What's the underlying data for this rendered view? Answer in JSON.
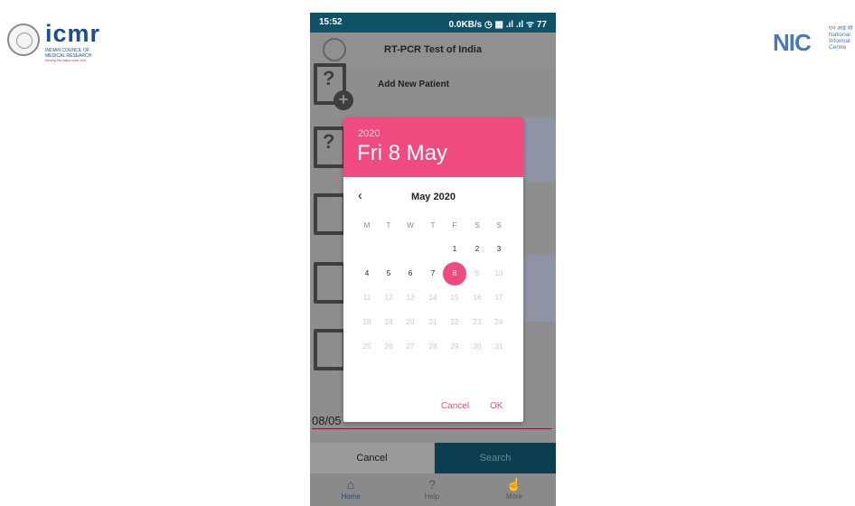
{
  "logos": {
    "left": {
      "word": "icmr",
      "line1": "INDIAN COUNCIL OF",
      "line2": "MEDICAL RESEARCH",
      "tagline": "Serving the nation since 1911"
    },
    "right": {
      "mark": "NIC",
      "line1": "एन आई सी",
      "line2": "National",
      "line3": "Informat",
      "line4": "Centre"
    }
  },
  "status_bar": {
    "time": "15:52",
    "right": "0.0KB/s ◷ ▦ .ıl .ıl ᯤ 77"
  },
  "app": {
    "title": "RT-PCR Test of India",
    "add_new_patient": "Add New Patient",
    "date_field_value": "08/05",
    "cancel_button": "Cancel",
    "search_button": "Search",
    "nav": [
      {
        "label": "Home",
        "icon": "home-icon",
        "glyph": "⌂"
      },
      {
        "label": "Help",
        "icon": "help-icon",
        "glyph": "?"
      },
      {
        "label": "More",
        "icon": "more-icon",
        "glyph": "☝"
      }
    ]
  },
  "date_picker": {
    "year": "2020",
    "selected_date": "Fri 8 May",
    "month_label": "May 2020",
    "prev_icon": "chevron-left-icon",
    "prev_glyph": "‹",
    "weekdays": [
      "M",
      "T",
      "W",
      "T",
      "F",
      "S",
      "S"
    ],
    "days": [
      [
        "",
        "",
        "",
        "",
        "1",
        "2",
        "3"
      ],
      [
        "4",
        "5",
        "6",
        "7",
        "8",
        "9",
        "10"
      ],
      [
        "11",
        "12",
        "13",
        "14",
        "15",
        "16",
        "17"
      ],
      [
        "18",
        "19",
        "20",
        "21",
        "22",
        "23",
        "24"
      ],
      [
        "25",
        "26",
        "27",
        "28",
        "29",
        "30",
        "31"
      ]
    ],
    "selected_day": "8",
    "max_enabled_day": 8,
    "cancel_label": "Cancel",
    "ok_label": "OK"
  },
  "colors": {
    "accent": "#ef4b80",
    "status_bar": "#0f5167",
    "search_button": "#0b3f50"
  }
}
